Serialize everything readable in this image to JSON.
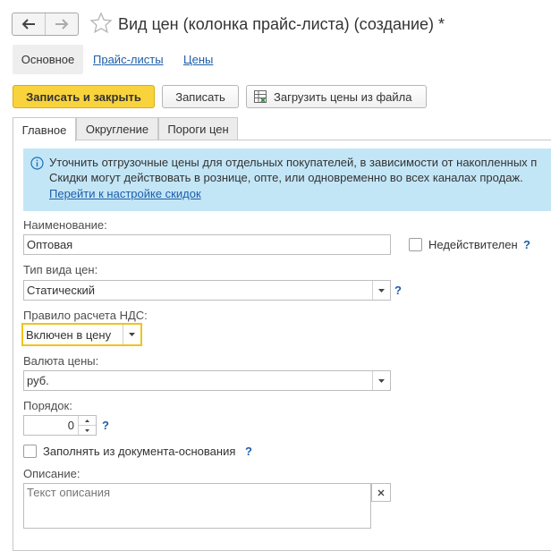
{
  "window": {
    "title": "Вид цен (колонка прайс-листа) (создание) *"
  },
  "sections": {
    "active": "Основное",
    "links": [
      "Прайс-листы",
      "Цены"
    ]
  },
  "commands": {
    "save_close": "Записать и закрыть",
    "save": "Записать",
    "load_prices": "Загрузить цены из файла"
  },
  "tabs": [
    "Главное",
    "Округление",
    "Пороги цен"
  ],
  "info": {
    "line1": "Уточнить отгрузочные цены для отдельных покупателей, в зависимости от накопленных п",
    "line2": "Скидки могут действовать в рознице, опте, или одновременно во всех каналах продаж.",
    "link": "Перейти к настройке скидок"
  },
  "form": {
    "name_label": "Наименование:",
    "name_value": "Оптовая",
    "inactive_label": "Недействителен",
    "inactive_checked": false,
    "price_type_label": "Тип вида цен:",
    "price_type_value": "Статический",
    "vat_label": "Правило расчета НДС:",
    "vat_value": "Включен в цену",
    "currency_label": "Валюта цены:",
    "currency_value": "руб.",
    "order_label": "Порядок:",
    "order_value": "0",
    "fill_from_basis_label": "Заполнять из документа-основания",
    "fill_from_basis_checked": false,
    "description_label": "Описание:",
    "description_placeholder": "Текст описания",
    "help_mark": "?"
  },
  "icons": {
    "back": "arrow-left-icon",
    "forward": "arrow-right-icon",
    "favorite": "star-icon",
    "info": "info-icon",
    "spreadsheet": "spreadsheet-icon",
    "dropdown": "chevron-down-icon",
    "clear": "close-icon"
  },
  "colors": {
    "primary_button": "#f8d33b",
    "info_background": "#c3e6f7",
    "link": "#1e5ea8",
    "focus": "#f0c419"
  }
}
